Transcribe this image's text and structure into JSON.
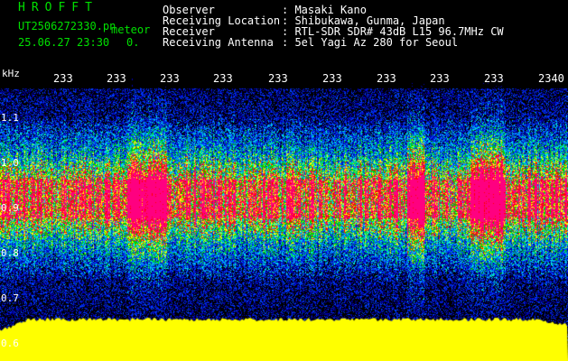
{
  "header": {
    "brand": "HROFFT",
    "filename": "UT2506272330.pn",
    "meteor": "meteor",
    "datetime": "25.06.27 23:30",
    "count": "0.",
    "observer_key": "Observer",
    "observer_val": ": Masaki Kano",
    "location_key": "Receiving Location",
    "location_val": ": Shibukawa, Gunma, Japan",
    "receiver_key": "Receiver",
    "receiver_val": ": RTL-SDR SDR# 43dB L15 96.7MHz CW",
    "antenna_key": "Receiving Antenna",
    "antenna_val": ": 5el Yagi Az 280 for Seoul"
  },
  "spectrogram": {
    "unit_label": "kHz",
    "y_ticks": [
      "1.1",
      "1.0",
      "0.9",
      "0.8",
      "0.7",
      "0.6"
    ],
    "x_ticks": [
      "233",
      "233",
      "233",
      "233",
      "233",
      "233",
      "233",
      "233",
      "233",
      "2340"
    ],
    "colors": {
      "background": "#000000",
      "dark_blue": "#0000b0",
      "blue": "#0040ff",
      "cyan": "#00e0e0",
      "green": "#00d000",
      "yellow": "#ffff00",
      "red": "#ff0000",
      "magenta": "#ff0080",
      "yellow_band": "#ffff00"
    }
  }
}
